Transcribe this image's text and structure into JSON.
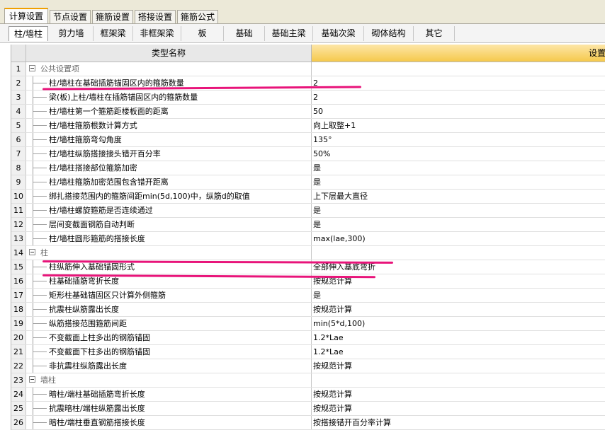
{
  "top_tabs": [
    "计算设置",
    "节点设置",
    "箍筋设置",
    "搭接设置",
    "箍筋公式"
  ],
  "sub_tabs": [
    "柱/墙柱",
    "剪力墙",
    "框架梁",
    "非框架梁",
    "板",
    "基础",
    "基础主梁",
    "基础次梁",
    "砌体结构",
    "其它"
  ],
  "grid": {
    "header_name": "类型名称",
    "header_value": "设置",
    "rows": [
      {
        "num": "1",
        "name": "公共设置项",
        "value": ""
      },
      {
        "num": "2",
        "name": "柱/墙柱在基础插筋锚固区内的箍筋数量",
        "value": "2"
      },
      {
        "num": "3",
        "name": "梁(板)上柱/墙柱在插筋锚固区内的箍筋数量",
        "value": "2"
      },
      {
        "num": "4",
        "name": "柱/墙柱第一个箍筋距楼板面的距离",
        "value": "50"
      },
      {
        "num": "5",
        "name": "柱/墙柱箍筋根数计算方式",
        "value": "向上取整+1"
      },
      {
        "num": "6",
        "name": "柱/墙柱箍筋弯勾角度",
        "value": "135°"
      },
      {
        "num": "7",
        "name": "柱/墙柱纵筋搭接接头错开百分率",
        "value": "50%"
      },
      {
        "num": "8",
        "name": "柱/墙柱搭接部位箍筋加密",
        "value": "是"
      },
      {
        "num": "9",
        "name": "柱/墙柱箍筋加密范围包含错开距离",
        "value": "是"
      },
      {
        "num": "10",
        "name": "绑扎搭接范围内的箍筋间距min(5d,100)中，纵筋d的取值",
        "value": "上下层最大直径"
      },
      {
        "num": "11",
        "name": "柱/墙柱螺旋箍筋是否连续通过",
        "value": "是"
      },
      {
        "num": "12",
        "name": "层间变截面钢筋自动判断",
        "value": "是"
      },
      {
        "num": "13",
        "name": "柱/墙柱圆形箍筋的搭接长度",
        "value": "max(lae,300)"
      },
      {
        "num": "14",
        "name": "柱",
        "value": ""
      },
      {
        "num": "15",
        "name": "柱纵筋伸入基础锚固形式",
        "value": "全部伸入基底弯折"
      },
      {
        "num": "16",
        "name": "柱基础插筋弯折长度",
        "value": "按规范计算"
      },
      {
        "num": "17",
        "name": "矩形柱基础锚固区只计算外侧箍筋",
        "value": "是"
      },
      {
        "num": "18",
        "name": "抗震柱纵筋露出长度",
        "value": "按规范计算"
      },
      {
        "num": "19",
        "name": "纵筋搭接范围箍筋间距",
        "value": "min(5*d,100)"
      },
      {
        "num": "20",
        "name": "不变截面上柱多出的钢筋锚固",
        "value": "1.2*Lae"
      },
      {
        "num": "21",
        "name": "不变截面下柱多出的钢筋锚固",
        "value": "1.2*Lae"
      },
      {
        "num": "22",
        "name": "非抗震柱纵筋露出长度",
        "value": "按规范计算"
      },
      {
        "num": "23",
        "name": "墙柱",
        "value": ""
      },
      {
        "num": "24",
        "name": "暗柱/端柱基础插筋弯折长度",
        "value": "按规范计算"
      },
      {
        "num": "25",
        "name": "抗震暗柱/端柱纵筋露出长度",
        "value": "按规范计算"
      },
      {
        "num": "26",
        "name": "暗柱/端柱垂直钢筋搭接长度",
        "value": "按搭接错开百分率计算"
      }
    ]
  },
  "annotation_color": "#e8147a"
}
